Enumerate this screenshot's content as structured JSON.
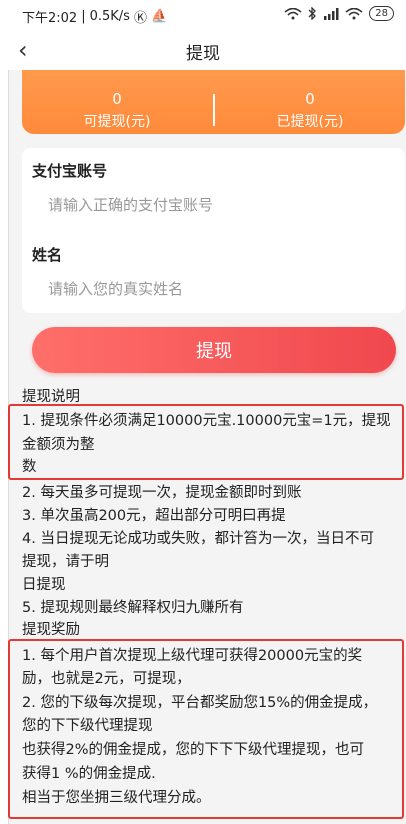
{
  "status_bar": {
    "time": "下午2:02",
    "separator": "|",
    "speed": "0.5K/s",
    "k_icon": "Ⓚ",
    "boat_icon": "⛵",
    "battery": "28"
  },
  "nav": {
    "back_icon": "‹",
    "title": "提现"
  },
  "balance": {
    "withdrawable_value": "0",
    "withdrawable_label": "可提现(元)",
    "withdrawn_value": "0",
    "withdrawn_label": "已提现(元)"
  },
  "form": {
    "alipay_label": "支付宝账号",
    "alipay_placeholder": "请输入正确的支付宝账号",
    "name_label": "姓名",
    "name_placeholder": "请输入您的真实姓名",
    "submit_label": "提现"
  },
  "instructions": {
    "heading": "提现说明",
    "rule1_line1": "1. 提现条件必须满足10000元宝.10000元宝=1元，提现",
    "rule1_line2": "金额须为整",
    "rule1_line3": "数",
    "rule2": "2. 每天虽多可提现一次，提现金额即时到账",
    "rule3": "3. 单次虽高200元，超出部分可明曰再提",
    "rule4_line1": "4. 当日提现无论成功或失败，都计笞为一次，当日不可",
    "rule4_line2": "提现，请于明",
    "rule4_line3": "日提现",
    "rule5": "5. 提现规则最终解释权归九赚所有"
  },
  "rewards": {
    "heading": "提现奖励",
    "r1_line1": "1. 每个用户首次提现上级代理可获得20000元宝的奖",
    "r1_line2": "励，也就是2元，可提现，",
    "r2_line1": "2. 您的下级每次提现，平台都奖励您15%的佣金提成，",
    "r2_line2": "您的下下级代理提现",
    "r2_line3": "也获得2%的佣金提成，您的下下下级代理提现，也可",
    "r2_line4": "获得1 %的佣金提成.",
    "r2_line5": "相当于您坐拥三级代理分成。"
  },
  "colors": {
    "orange": "#ff8f3f",
    "button_red": "#f0484e",
    "highlight_red": "#e53935"
  }
}
